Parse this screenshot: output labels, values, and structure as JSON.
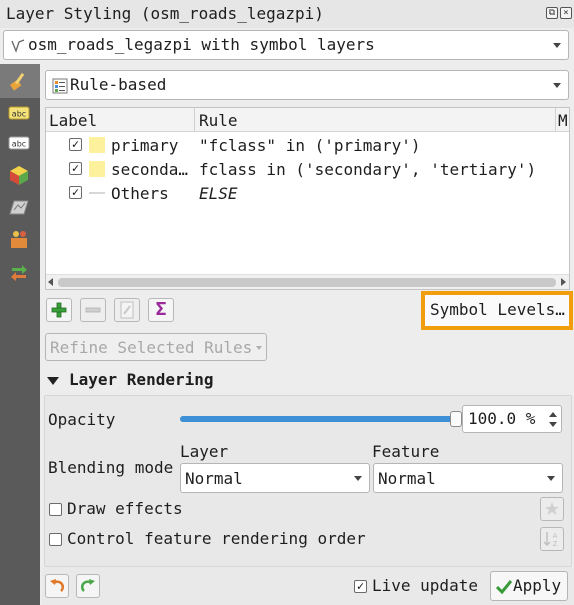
{
  "window": {
    "title": "Layer Styling (osm_roads_legazpi)"
  },
  "layer_select": {
    "value": "osm_roads_legazpi with symbol layers"
  },
  "renderer_select": {
    "value": "Rule-based"
  },
  "sidebar": {
    "items": [
      {
        "icon": "paintbrush-icon"
      },
      {
        "icon": "labels-icon"
      },
      {
        "icon": "masks-icon"
      },
      {
        "icon": "3d-view-icon"
      },
      {
        "icon": "diagrams-icon"
      },
      {
        "icon": "fields-icon"
      },
      {
        "icon": "history-icon"
      }
    ]
  },
  "rules_tree": {
    "columns": [
      "Label",
      "Rule",
      "M"
    ],
    "rows": [
      {
        "checked": "✓",
        "label": "primary",
        "rule": "\"fclass\" in ('primary')",
        "swatch": "#fdf19e"
      },
      {
        "checked": "✓",
        "label": "seconda…",
        "rule": "fclass in ('secondary', 'tertiary')",
        "swatch": "#fdf19e"
      },
      {
        "checked": "✓",
        "label": "Others",
        "rule": "ELSE",
        "swatch": "none"
      }
    ]
  },
  "toolbar": {
    "add_icon": "plus-icon",
    "remove_icon": "minus-icon",
    "edit_icon": "edit-icon",
    "sum_symbol": "Σ",
    "symbol_levels_label": "Symbol Levels…",
    "refine_label": "Refine Selected Rules"
  },
  "layer_rendering": {
    "section_title": "Layer Rendering",
    "opacity_label": "Opacity",
    "opacity_value": "100.0 %",
    "opacity_fraction": 1.0,
    "blending_label": "Blending mode",
    "layer_label": "Layer",
    "layer_blend": "Normal",
    "feature_label": "Feature",
    "feature_blend": "Normal",
    "draw_effects_label": "Draw effects",
    "control_order_label": "Control feature rendering order"
  },
  "bottom": {
    "live_update_label": "Live update",
    "live_update_checked": "✓",
    "apply_label": "Apply"
  },
  "colors": {
    "accent": "#3d8fd6",
    "highlight": "#f29d0b"
  }
}
